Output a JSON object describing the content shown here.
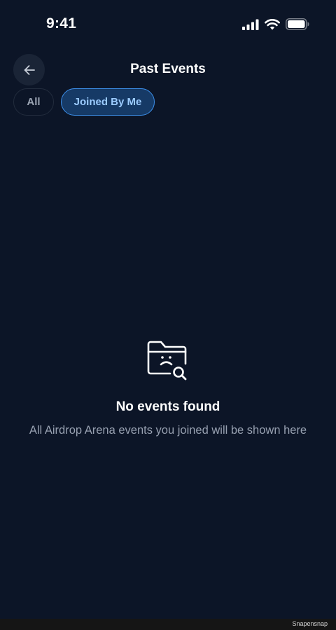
{
  "status_bar": {
    "time": "9:41",
    "icons": [
      "signal-icon",
      "wifi-icon",
      "battery-icon"
    ]
  },
  "header": {
    "title": "Past Events",
    "back_icon": "arrow-left-icon"
  },
  "filters": {
    "all_label": "All",
    "joined_label": "Joined By Me",
    "selected": "Joined By Me"
  },
  "empty_state": {
    "icon": "folder-sad-search-icon",
    "title": "No events found",
    "message": "All Airdrop Arena events you joined will be shown here"
  },
  "footer": {
    "watermark": "Snapensnap"
  },
  "colors": {
    "background": "#0c1527",
    "chip_selected_bg": "#163a66",
    "chip_selected_border": "#3c8ee8",
    "chip_selected_text": "#9cccff",
    "muted_text": "#97a0b0"
  }
}
